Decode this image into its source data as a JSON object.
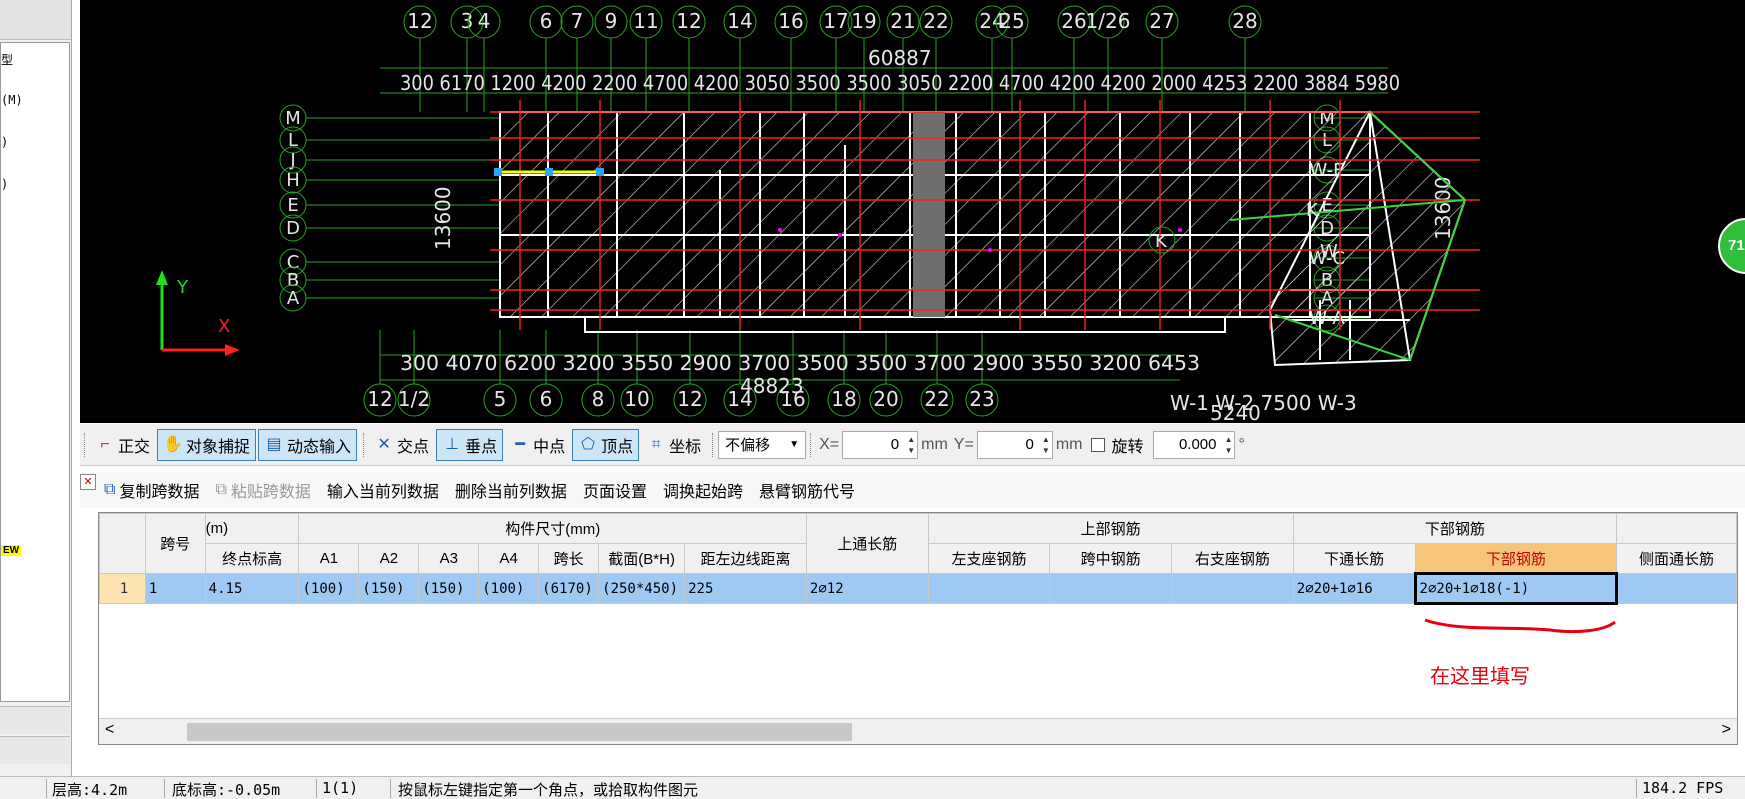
{
  "left_panel": {
    "items": [
      "型",
      "(M)",
      ")",
      ")"
    ],
    "new_badge": "EW"
  },
  "cad": {
    "top_axes": [
      "12",
      "3",
      "4",
      "6",
      "7",
      "9",
      "11",
      "12",
      "14",
      "16",
      "17",
      "19",
      "21",
      "22",
      "24",
      "25",
      "26",
      "1/26",
      "27",
      "28"
    ],
    "top_total_dim": "60887",
    "top_dims": "300 6170 1200 4200 2200 4700 4200 3050 3500 3500 3050 2200 4700 4200 4200 2000 4253 2200 3884 5980",
    "bottom_axes": [
      "12",
      "1/2",
      "5",
      "6",
      "8",
      "10",
      "12",
      "14",
      "16",
      "18",
      "20",
      "22",
      "23"
    ],
    "bottom_total_dim": "48823",
    "bottom_dims": "300 4070 6200 3200 3550 2900 3700 3500 3500 3700 2900 3550 3200 6453",
    "left_axes": [
      "M",
      "L",
      "J",
      "H",
      "E",
      "D",
      "C",
      "B",
      "A"
    ],
    "left_dim": "13600",
    "right_axes": [
      "M",
      "L",
      "W-E",
      "E",
      "D",
      "W-C",
      "B",
      "A",
      "W-A"
    ],
    "right_dim": "13600",
    "bottom_right_labels": "W-1 W-2 7500 W-3",
    "bottom_right_dim": "5240",
    "label_k1": "K",
    "label_k2": "K",
    "label_w": "W",
    "axis_y": "Y",
    "axis_x": "X"
  },
  "snap_toolbar": {
    "ortho": "正交",
    "object_snap": "对象捕捉",
    "dynamic_input": "动态输入",
    "intersection": "交点",
    "perpendicular": "垂点",
    "midpoint": "中点",
    "vertex": "顶点",
    "coordinate": "坐标",
    "offset_mode": "不偏移",
    "x_label": "X=",
    "x_value": "0",
    "y_label": "Y=",
    "y_value": "0",
    "unit": "mm",
    "rotate": "旋转",
    "rotate_value": "0.000",
    "degree": "°"
  },
  "table_toolbar": {
    "copy_span": "复制跨数据",
    "paste_span": "粘贴跨数据",
    "input_col": "输入当前列数据",
    "delete_col": "删除当前列数据",
    "page_setup": "页面设置",
    "swap_start": "调换起始跨",
    "cantilever": "悬臂钢筋代号"
  },
  "grid": {
    "group_headers": {
      "span_no": "跨号",
      "elevation": "(m)",
      "size": "构件尺寸(mm)",
      "top_long": "上通长筋",
      "top_rebar": "上部钢筋",
      "bottom_rebar": "下部钢筋"
    },
    "sub_headers": {
      "end_elev": "终点标高",
      "a1": "A1",
      "a2": "A2",
      "a3": "A3",
      "a4": "A4",
      "span_len": "跨长",
      "section": "截面(B*H)",
      "edge_dist": "距左边线距离",
      "left_support": "左支座钢筋",
      "mid_span": "跨中钢筋",
      "right_support": "右支座钢筋",
      "bottom_long": "下通长筋",
      "bottom_bar": "下部钢筋",
      "side_long": "侧面通长筋"
    },
    "rows": [
      {
        "row_no": "1",
        "span": "1",
        "end_elev": "4.15",
        "a1": "(100)",
        "a2": "(150)",
        "a3": "(150)",
        "a4": "(100)",
        "span_len": "(6170)",
        "section": "(250*450)",
        "edge_dist": "225",
        "top_long": "2⌀12",
        "left_support": "",
        "mid_span": "",
        "right_support": "",
        "bottom_long": "2⌀20+1⌀16",
        "bottom_bar": "2⌀20+1⌀18(-1)",
        "side_long": ""
      }
    ]
  },
  "annotation": "在这里填写",
  "status_bar": {
    "floor_height": "层高:4.2m",
    "base_elev": "底标高:-0.05m",
    "count": "1(1)",
    "hint": "按鼠标左键指定第一个角点，或拾取构件图元",
    "fps": "184.2 FPS"
  },
  "side_badge": "71",
  "colors": {
    "cad_bg": "#000000",
    "axis_green": "#1fa81f",
    "beam_red": "#ff2020",
    "wall_white": "#ffffff",
    "selected_row": "#9ec9f2",
    "highlight_header": "#f6c57a",
    "annotation_red": "#e8000c"
  }
}
